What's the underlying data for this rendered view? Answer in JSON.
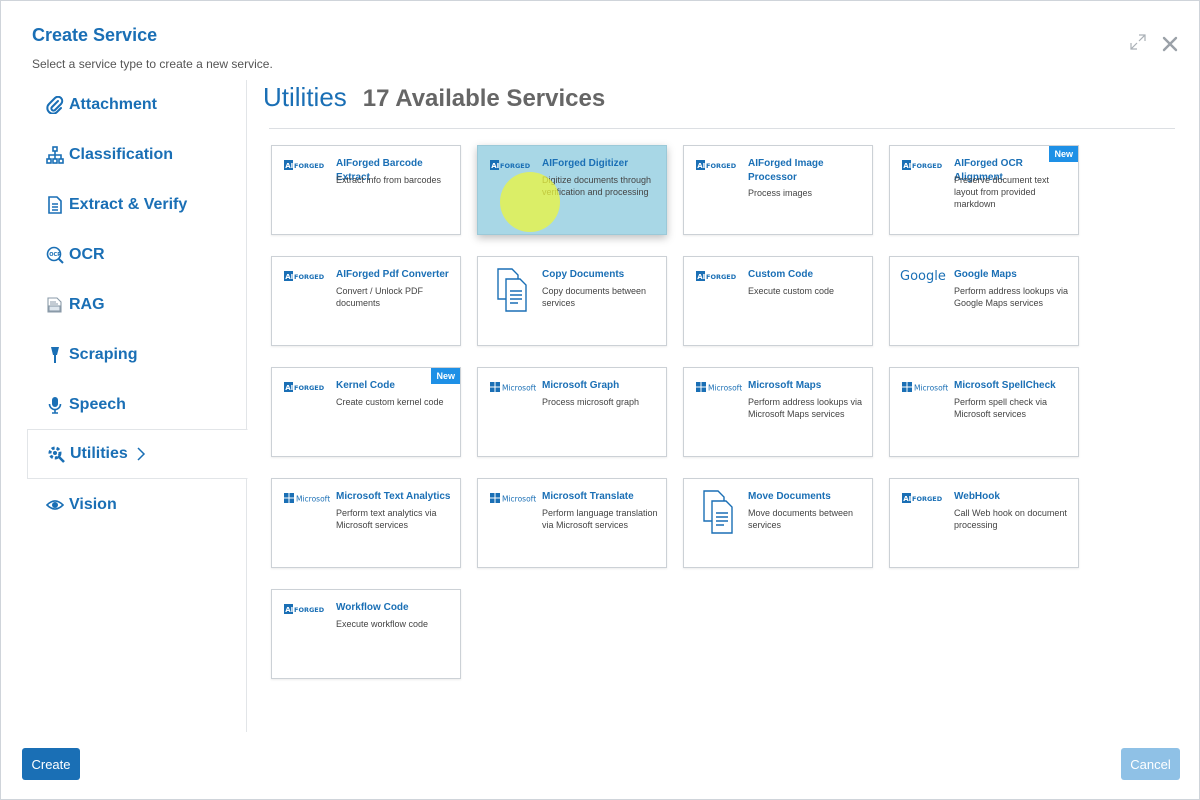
{
  "dialog": {
    "title": "Create Service",
    "subtitle": "Select a service type to create a new service.",
    "expand_icon": "expand-icon",
    "close_icon": "close-icon"
  },
  "sidebar": {
    "items": [
      {
        "label": "Attachment",
        "icon": "paperclip-icon"
      },
      {
        "label": "Classification",
        "icon": "hierarchy-icon"
      },
      {
        "label": "Extract & Verify",
        "icon": "document-list-icon"
      },
      {
        "label": "OCR",
        "icon": "ocr-icon"
      },
      {
        "label": "RAG",
        "icon": "rag-icon"
      },
      {
        "label": "Scraping",
        "icon": "scraper-icon"
      },
      {
        "label": "Speech",
        "icon": "microphone-icon"
      },
      {
        "label": "Utilities",
        "icon": "gear-wrench-icon",
        "active": true
      },
      {
        "label": "Vision",
        "icon": "eye-icon"
      }
    ]
  },
  "main": {
    "title": "Utilities",
    "count_text": "17 Available Services"
  },
  "services": [
    {
      "title": "AIForged Barcode Extract",
      "desc": "Extract info from barcodes",
      "logo": "aiforged"
    },
    {
      "title": "AIForged Digitizer",
      "desc": "Digitize documents through verification and processing",
      "logo": "aiforged",
      "selected": true
    },
    {
      "title": "AIForged Image Processor",
      "desc": "Process images",
      "logo": "aiforged"
    },
    {
      "title": "AIForged OCR Alignment",
      "desc": "Preserve document text layout from provided markdown",
      "logo": "aiforged",
      "badge": "New"
    },
    {
      "title": "AIForged Pdf Converter",
      "desc": "Convert / Unlock PDF documents",
      "logo": "aiforged"
    },
    {
      "title": "Copy Documents",
      "desc": "Copy documents between services",
      "logo": "documents"
    },
    {
      "title": "Custom Code",
      "desc": "Execute custom code",
      "logo": "aiforged"
    },
    {
      "title": "Google Maps",
      "desc": "Perform address lookups via Google Maps services",
      "logo": "google"
    },
    {
      "title": "Kernel Code",
      "desc": "Create custom kernel code",
      "logo": "aiforged",
      "badge": "New"
    },
    {
      "title": "Microsoft Graph",
      "desc": "Process microsoft graph",
      "logo": "microsoft"
    },
    {
      "title": "Microsoft Maps",
      "desc": "Perform address lookups via Microsoft Maps services",
      "logo": "microsoft"
    },
    {
      "title": "Microsoft SpellCheck",
      "desc": "Perform spell check via Microsoft services",
      "logo": "microsoft"
    },
    {
      "title": "Microsoft Text Analytics",
      "desc": "Perform text analytics via Microsoft services",
      "logo": "microsoft"
    },
    {
      "title": "Microsoft Translate",
      "desc": "Perform language translation via Microsoft services",
      "logo": "microsoft"
    },
    {
      "title": "Move Documents",
      "desc": "Move documents between services",
      "logo": "documents"
    },
    {
      "title": "WebHook",
      "desc": "Call Web hook on document processing",
      "logo": "aiforged"
    },
    {
      "title": "Workflow Code",
      "desc": "Execute workflow code",
      "logo": "aiforged"
    }
  ],
  "logos": {
    "aiforged_text": "AIFORGED",
    "microsoft_text": "Microsoft",
    "google_text": "Google"
  },
  "footer": {
    "create_label": "Create",
    "cancel_label": "Cancel"
  },
  "colors": {
    "accent": "#1a6fb5",
    "selected_card": "#a8d7e6",
    "badge": "#1e90e6",
    "cancel_disabled": "#8fc1e6"
  }
}
